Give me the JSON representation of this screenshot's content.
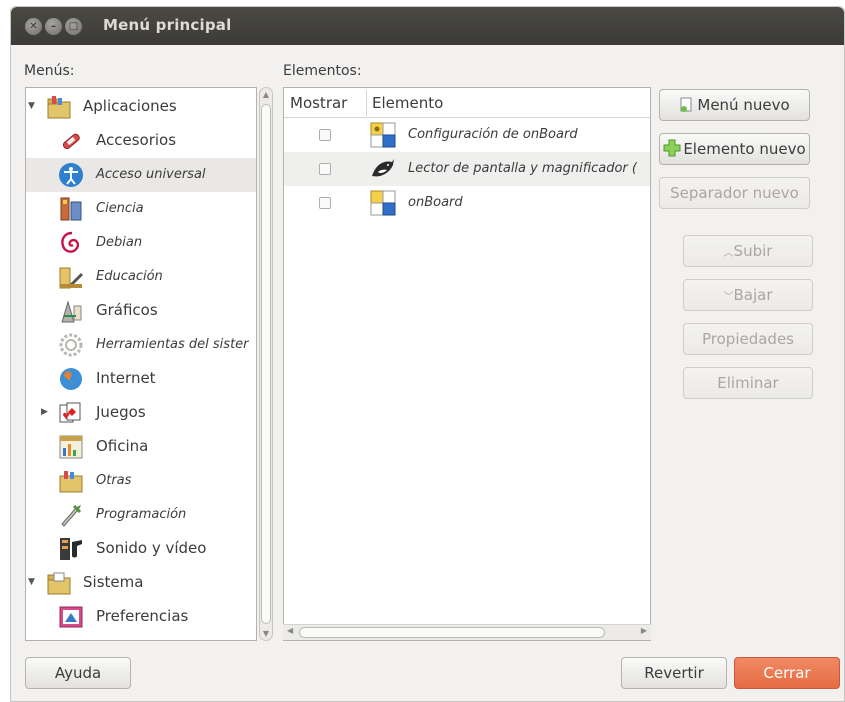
{
  "window": {
    "title": "Menú principal"
  },
  "labels": {
    "menus": "Menús:",
    "elements": "Elementos:"
  },
  "menu_tree": [
    {
      "label": "Aplicaciones",
      "icon": "applications-folder-icon",
      "level": 0,
      "expanded": true,
      "italic": false
    },
    {
      "label": "Accesorios",
      "icon": "accessories-icon",
      "level": 1,
      "italic": false
    },
    {
      "label": "Acceso universal",
      "icon": "universal-access-icon",
      "level": 1,
      "italic": true,
      "selected": true
    },
    {
      "label": "Ciencia",
      "icon": "science-icon",
      "level": 1,
      "italic": true
    },
    {
      "label": "Debian",
      "icon": "debian-icon",
      "level": 1,
      "italic": true
    },
    {
      "label": "Educación",
      "icon": "education-icon",
      "level": 1,
      "italic": true
    },
    {
      "label": "Gráficos",
      "icon": "graphics-icon",
      "level": 1,
      "italic": false
    },
    {
      "label": "Herramientas del sister",
      "icon": "system-tools-icon",
      "level": 1,
      "italic": true
    },
    {
      "label": "Internet",
      "icon": "internet-globe-icon",
      "level": 1,
      "italic": false
    },
    {
      "label": "Juegos",
      "icon": "games-cards-icon",
      "level": 1,
      "italic": false,
      "collapsed": true
    },
    {
      "label": "Oficina",
      "icon": "office-icon",
      "level": 1,
      "italic": false
    },
    {
      "label": "Otras",
      "icon": "other-folder-icon",
      "level": 1,
      "italic": true
    },
    {
      "label": "Programación",
      "icon": "programming-icon",
      "level": 1,
      "italic": true
    },
    {
      "label": "Sonido y vídeo",
      "icon": "multimedia-icon",
      "level": 1,
      "italic": false
    },
    {
      "label": "Sistema",
      "icon": "system-folder-icon",
      "level": 0,
      "expanded": true,
      "italic": false
    },
    {
      "label": "Preferencias",
      "icon": "preferences-icon",
      "level": 1,
      "italic": false
    }
  ],
  "elements_table": {
    "columns": [
      "Mostrar",
      "Elemento"
    ],
    "rows": [
      {
        "show": false,
        "label": "Configuración de onBoard",
        "icon": "onboard-settings-icon"
      },
      {
        "show": false,
        "label": "Lector de pantalla y magnificador (",
        "icon": "orca-icon"
      },
      {
        "show": false,
        "label": "onBoard",
        "icon": "onboard-icon"
      }
    ]
  },
  "buttons": {
    "new_menu": "Menú nuevo",
    "new_item": "Elemento nuevo",
    "new_separator": "Separador nuevo",
    "move_up": "Subir",
    "move_down": "Bajar",
    "properties": "Propiedades",
    "delete": "Eliminar",
    "help": "Ayuda",
    "revert": "Revertir",
    "close": "Cerrar"
  },
  "colors": {
    "accent": "#e9693f",
    "titlebar": "#3c3b37"
  }
}
